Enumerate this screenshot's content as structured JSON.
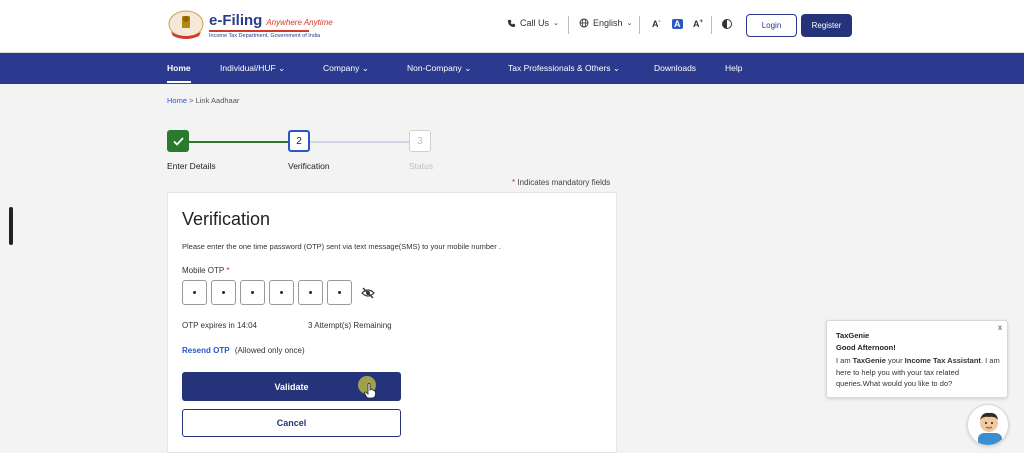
{
  "header": {
    "brand_main": "e-Filing",
    "brand_tagline": "Anywhere Anytime",
    "brand_sub": "Income Tax Department, Government of India",
    "call_us": "Call Us",
    "language": "English",
    "font_decrease": "A",
    "font_normal": "A",
    "font_increase": "A",
    "login": "Login",
    "register": "Register"
  },
  "nav": {
    "items": [
      "Home",
      "Individual/HUF",
      "Company",
      "Non-Company",
      "Tax Professionals & Others",
      "Downloads",
      "Help"
    ]
  },
  "breadcrumb": {
    "home": "Home",
    "separator": ">",
    "current": "Link Aadhaar"
  },
  "stepper": {
    "steps": [
      {
        "label": "Enter Details",
        "status": "completed"
      },
      {
        "number": "2",
        "label": "Verification",
        "status": "active"
      },
      {
        "number": "3",
        "label": "Status",
        "status": "pending"
      }
    ]
  },
  "mandatory_note": {
    "star": "*",
    "text": "Indicates mandatory fields"
  },
  "form": {
    "title": "Verification",
    "description": "Please enter the one time password (OTP) sent via text message(SMS) to your mobile number .",
    "otp_label": "Mobile OTP",
    "required_star": "*",
    "otp_digits": [
      "•",
      "•",
      "•",
      "•",
      "•",
      "•"
    ],
    "expiry_text": "OTP expires in 14:04",
    "attempts_text": "3 Attempt(s) Remaining",
    "resend_link": "Resend OTP",
    "resend_note": "(Allowed only once)",
    "validate_label": "Validate",
    "cancel_label": "Cancel"
  },
  "chat": {
    "close": "x",
    "name": "TaxGenie",
    "greeting": "Good Afternoon!",
    "msg_prefix": "I am ",
    "msg_name": "TaxGenie",
    "msg_mid": " your ",
    "msg_role": "Income Tax Assistant",
    "msg_suffix": ". I am here to help you with your tax related queries.What would you like to do?"
  },
  "colors": {
    "primary": "#2b3a8f",
    "success": "#2a7a2e",
    "link": "#2b57c4",
    "required": "#c62828"
  }
}
